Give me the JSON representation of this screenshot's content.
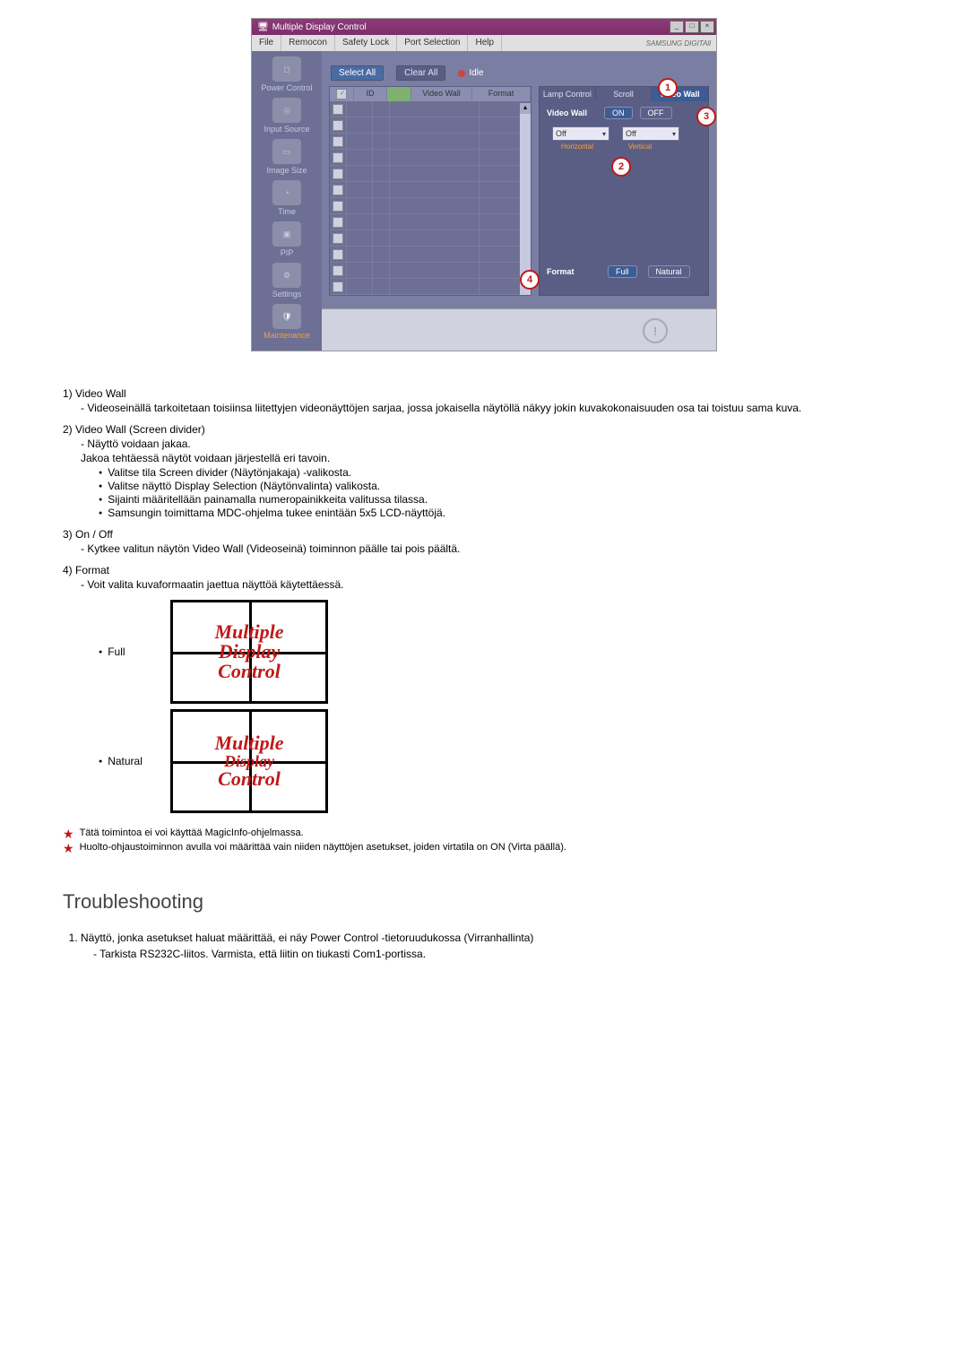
{
  "app": {
    "title": "Multiple Display Control",
    "brand": "SAMSUNG DIGITAll"
  },
  "menu": [
    "File",
    "Remocon",
    "Safety Lock",
    "Port Selection",
    "Help"
  ],
  "sidebar": [
    {
      "label": "Power Control"
    },
    {
      "label": "Input Source"
    },
    {
      "label": "Image Size"
    },
    {
      "label": "Time"
    },
    {
      "label": "PIP"
    },
    {
      "label": "Settings"
    },
    {
      "label": "Maintenance"
    }
  ],
  "toolbar": {
    "select_all": "Select All",
    "clear_all": "Clear All",
    "idle": "Idle"
  },
  "grid_headers": {
    "chk": "✓",
    "id": "ID",
    "chk2": "",
    "vw": "Video Wall",
    "fmt": "Format"
  },
  "tabs": {
    "lamp": "Lamp Control",
    "scroll": "Scroll",
    "video_wall": "Video Wall"
  },
  "panel": {
    "video_wall_label": "Video Wall",
    "on": "ON",
    "off": "OFF",
    "dd_off": "Off",
    "horizontal": "Horizontal",
    "vertical": "Vertical",
    "format_label": "Format",
    "full": "Full",
    "natural": "Natural"
  },
  "badges": {
    "b1": "1",
    "b2": "2",
    "b3": "3",
    "b4": "4"
  },
  "doc": {
    "item1_title": "1) Video Wall",
    "item1_sub": "Videoseinällä tarkoitetaan toisiinsa liitettyjen videonäyttöjen sarjaa, jossa jokaisella näytöllä näkyy jokin kuvakokonaisuuden osa tai toistuu sama kuva.",
    "item2_title": "2) Video Wall (Screen divider)",
    "item2_sub1": "Näyttö voidaan jakaa.",
    "item2_sub2": "Jakoa tehtäessä näytöt voidaan järjestellä eri tavoin.",
    "item2_b1": "Valitse tila Screen divider (Näytönjakaja) -valikosta.",
    "item2_b2": "Valitse näyttö Display Selection (Näytönvalinta) valikosta.",
    "item2_b3": "Sijainti määritellään painamalla numeropainikkeita valitussa tilassa.",
    "item2_b4": "Samsungin toimittama MDC-ohjelma tukee enintään 5x5 LCD-näyttöjä.",
    "item3_title": "3) On / Off",
    "item3_sub": "Kytkee valitun näytön Video Wall (Videoseinä) toiminnon päälle tai pois päältä.",
    "item4_title": "4) Format",
    "item4_sub": "Voit valita kuvaformaatin jaettua näyttöä käytettäessä.",
    "full": "Full",
    "natural": "Natural",
    "sample_line1": "Multiple",
    "sample_line2": "Display",
    "sample_line3": "Control"
  },
  "notes": {
    "n1": "Tätä toimintoa ei voi käyttää MagicInfo-ohjelmassa.",
    "n2": "Huolto-ohjaustoiminnon avulla voi määrittää vain niiden näyttöjen asetukset, joiden virtatila on ON (Virta päällä)."
  },
  "troubleshooting": {
    "heading": "Troubleshooting",
    "t1": "Näyttö, jonka asetukset haluat määrittää, ei näy Power Control -tietoruudukossa (Virranhallinta)",
    "t1_sub": "Tarkista RS232C-liitos. Varmista, että liitin on tiukasti Com1-portissa."
  }
}
